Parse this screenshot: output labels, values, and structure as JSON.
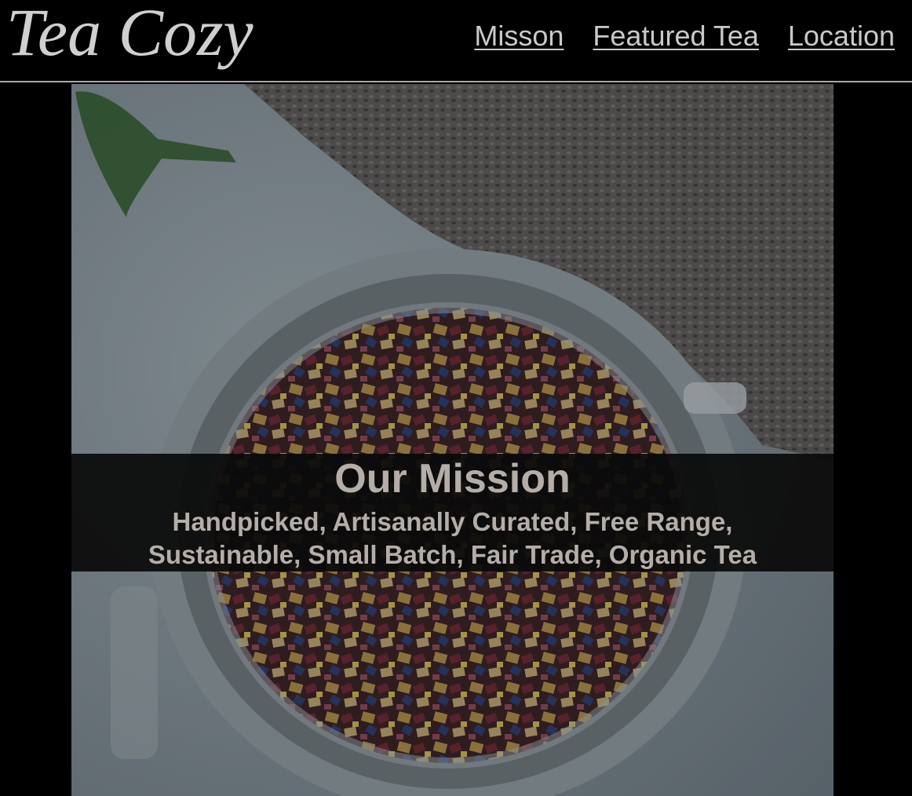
{
  "brand": {
    "name": "Tea Cozy"
  },
  "nav": {
    "items": [
      {
        "label": "Misson"
      },
      {
        "label": "Featured Tea"
      },
      {
        "label": "Location"
      }
    ]
  },
  "hero": {
    "image": "tea-jar-photo",
    "title": "Our Mission",
    "subtitle_line1": "Handpicked, Artisanally Curated, Free Range,",
    "subtitle_line2": "Sustainable, Small Batch, Fair Trade, Organic Tea"
  },
  "colors": {
    "background": "#000000",
    "nav_text": "#c9c9c9",
    "banner_text": "#b5aea8",
    "divider": "#a9a9a9"
  }
}
